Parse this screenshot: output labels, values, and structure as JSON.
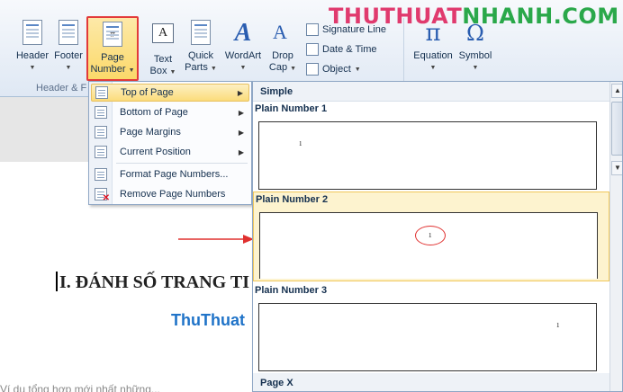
{
  "watermark": {
    "part1": "THUTHUAT",
    "part2": "NHANH.COM"
  },
  "ribbon": {
    "header_label": "Header",
    "footer_label": "Footer",
    "page_number_line1": "Page",
    "page_number_line2": "Number",
    "text_box_line1": "Text",
    "text_box_line2": "Box",
    "quick_parts_line1": "Quick",
    "quick_parts_line2": "Parts",
    "wordart_label": "WordArt",
    "drop_cap_line1": "Drop",
    "drop_cap_line2": "Cap",
    "signature_line": "Signature Line",
    "date_time": "Date & Time",
    "object": "Object",
    "equation": "Equation",
    "symbol": "Symbol",
    "group_header_footer": "Header & F"
  },
  "menu": {
    "items": [
      {
        "label": "Top of Page",
        "has_submenu": true,
        "highlighted": true
      },
      {
        "label": "Bottom of Page",
        "has_submenu": true
      },
      {
        "label": "Page Margins",
        "has_submenu": true
      },
      {
        "label": "Current Position",
        "has_submenu": true
      },
      {
        "label": "Format Page Numbers...",
        "has_submenu": false
      },
      {
        "label": "Remove Page Numbers",
        "has_submenu": false
      }
    ]
  },
  "gallery": {
    "section_simple": "Simple",
    "items": [
      {
        "title": "Plain Number 1",
        "number": "1"
      },
      {
        "title": "Plain Number 2",
        "number": "1",
        "highlighted": true
      },
      {
        "title": "Plain Number 3",
        "number": "1"
      }
    ],
    "section_page_x": "Page X"
  },
  "document": {
    "heading": "I. ĐÁNH SỐ TRANG TI",
    "subheading": "ThuThuat",
    "faded_line": "Ví dụ tổng hợp mới nhất những..."
  },
  "colors": {
    "accent_red": "#e23a3a",
    "highlight_yellow": "#fbd96a",
    "link_blue": "#1f73c8"
  }
}
